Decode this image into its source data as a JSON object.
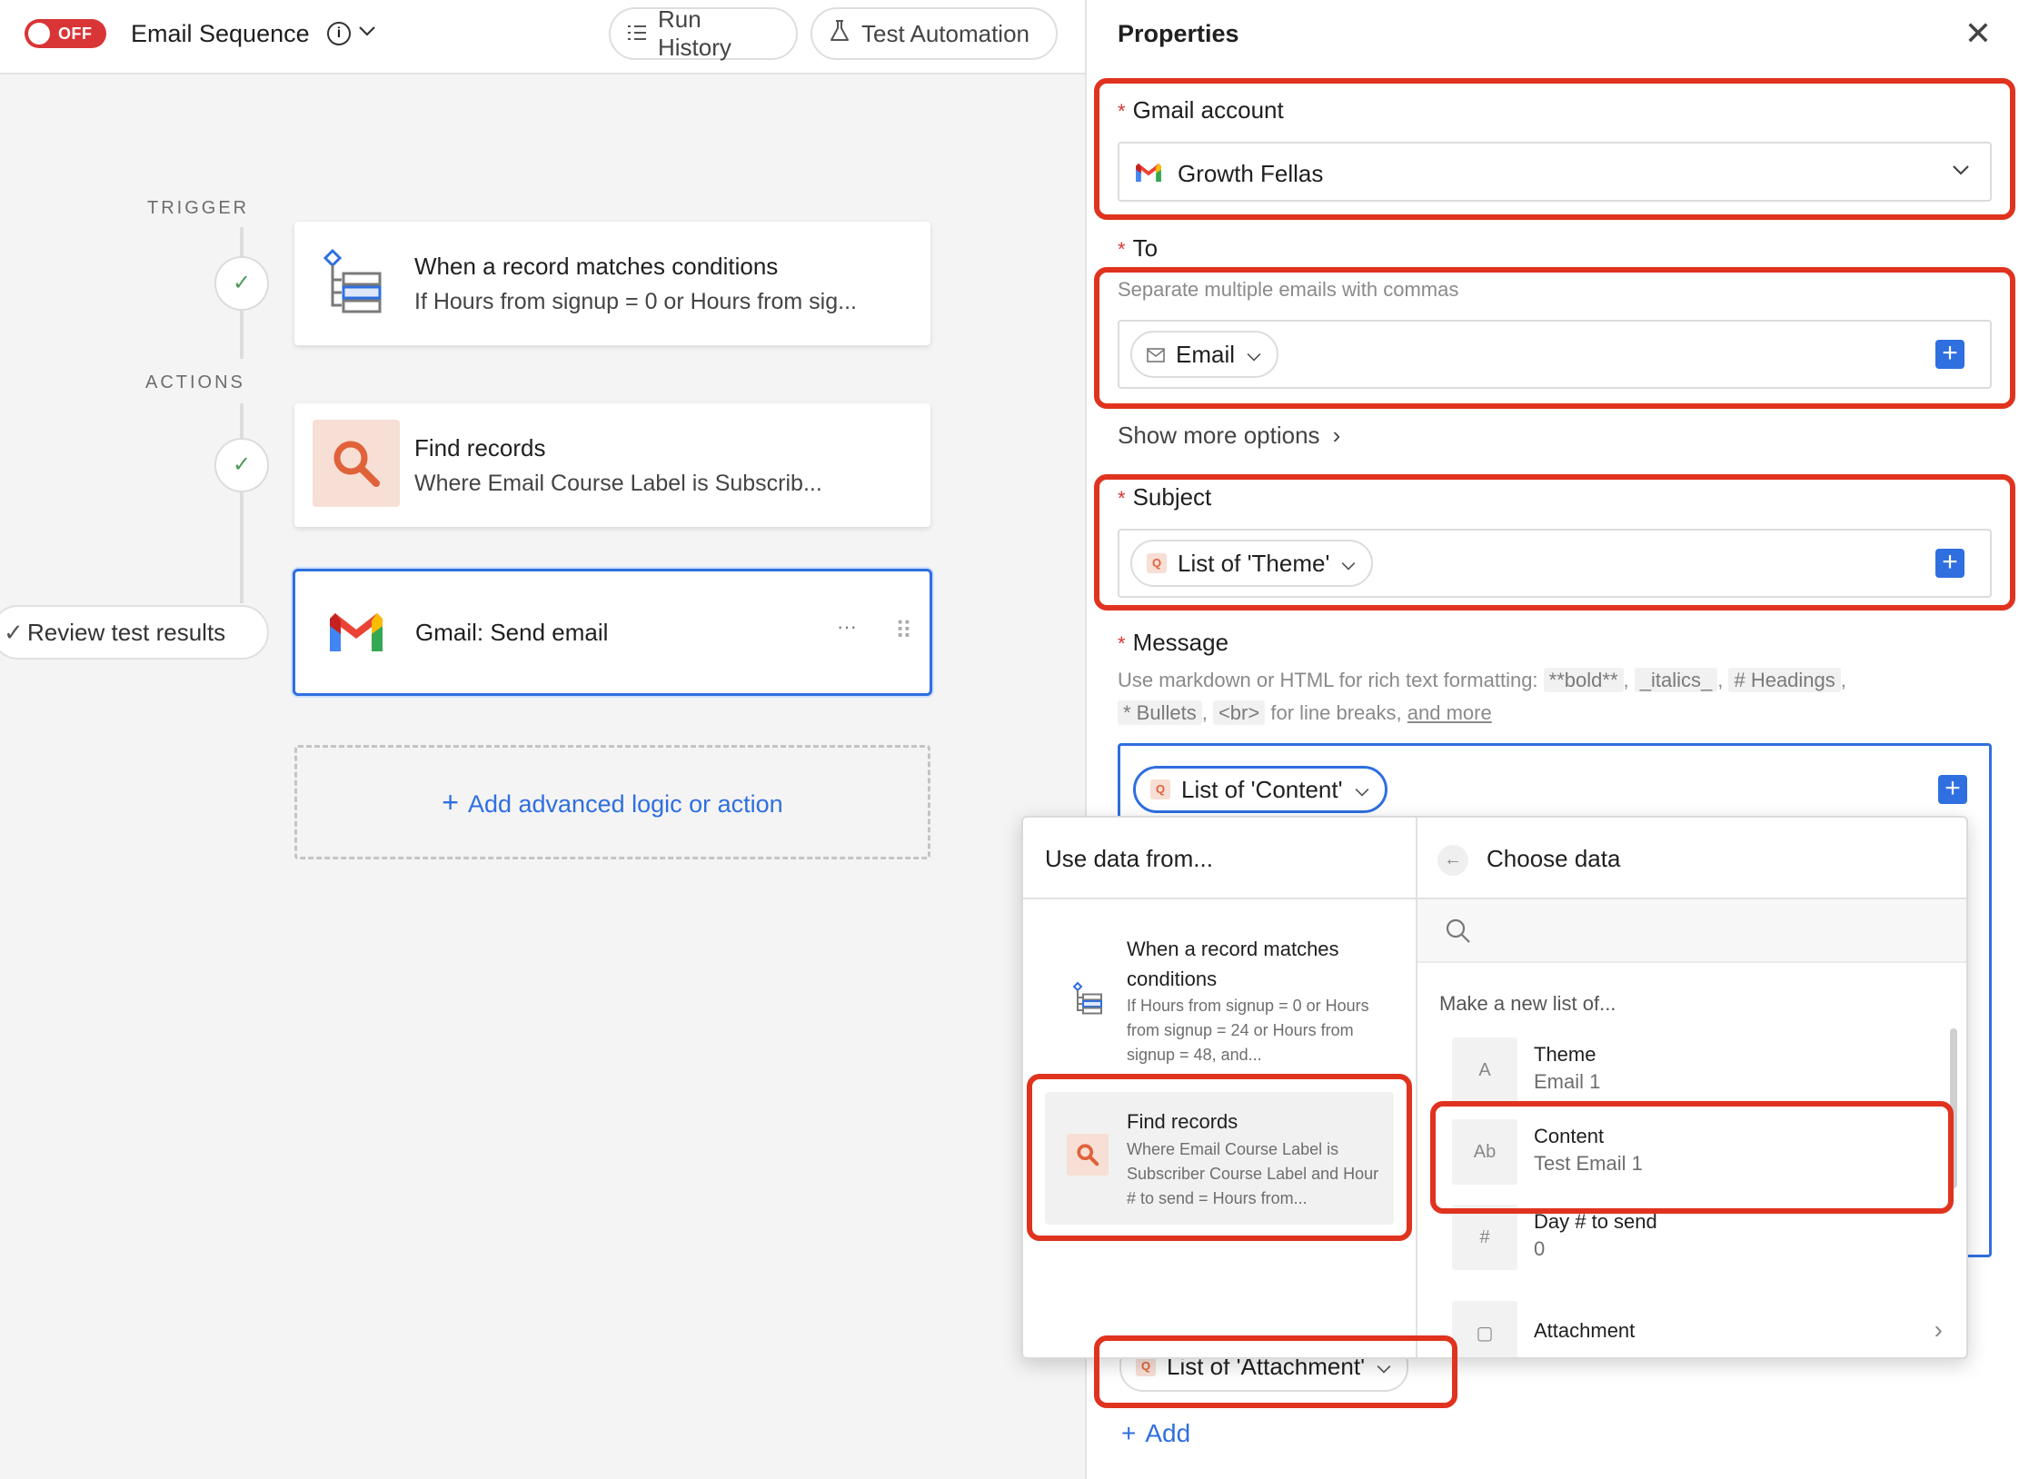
{
  "topbar": {
    "toggle_label": "OFF",
    "title": "Email Sequence",
    "info": "i",
    "chevron": "⌄",
    "run_history": "Run History",
    "test_automation": "Test Automation"
  },
  "flow": {
    "trigger_label": "TRIGGER",
    "actions_label": "ACTIONS",
    "check": "✓",
    "trigger_card": {
      "title": "When a record matches conditions",
      "subtitle": "If Hours from signup = 0 or Hours from sig..."
    },
    "find_card": {
      "title": "Find records",
      "subtitle": "Where Email Course Label is Subscrib..."
    },
    "gmail_card": {
      "title": "Gmail: Send email",
      "more": "···",
      "drag": "⠿"
    },
    "review_label": "Review test results",
    "add_logic_label": "Add advanced logic or action"
  },
  "panel": {
    "title": "Properties",
    "close": "✕",
    "required_mark": "*",
    "gmail_account": {
      "label": "Gmail account",
      "value": "Growth Fellas"
    },
    "to": {
      "label": "To",
      "hint": "Separate multiple emails with commas",
      "token": "Email"
    },
    "show_more": "Show more options",
    "subject": {
      "label": "Subject",
      "token": "List of 'Theme'"
    },
    "message": {
      "label": "Message",
      "hint_prefix": "Use markdown or HTML for rich text formatting:",
      "code_bold": "**bold**",
      "code_italics": "_italics_",
      "code_headings": "# Headings",
      "code_bullets": "* Bullets",
      "code_br": "<br>",
      "hint_mid": "for line breaks,",
      "hint_link": "and more",
      "token": "List of 'Content'"
    },
    "attachment_token": "List of 'Attachment'",
    "add_label": "Add"
  },
  "popover": {
    "left_title": "Use data from...",
    "right_title": "Choose data",
    "sources": [
      {
        "title": "When a record matches conditions",
        "subtitle": "If Hours from signup = 0 or Hours from signup = 24 or Hours from signup = 48, and..."
      },
      {
        "title": "Find records",
        "subtitle": "Where Email Course Label is Subscriber Course Label and Hour # to send = Hours from..."
      }
    ],
    "make_new_list": "Make a new list of...",
    "options": [
      {
        "title": "Theme",
        "subtitle": "Email 1",
        "icon": "A"
      },
      {
        "title": "Content",
        "subtitle": "Test Email 1",
        "icon": "Ab"
      },
      {
        "title": "Day # to send",
        "subtitle": "0",
        "icon": "#"
      },
      {
        "title": "Attachment",
        "subtitle": "",
        "icon": "▢"
      }
    ]
  },
  "colors": {
    "accent_blue": "#2f6fe0",
    "off_red": "#d93536",
    "annotation_red": "#e0331f",
    "find_orange": "#e0623b"
  }
}
